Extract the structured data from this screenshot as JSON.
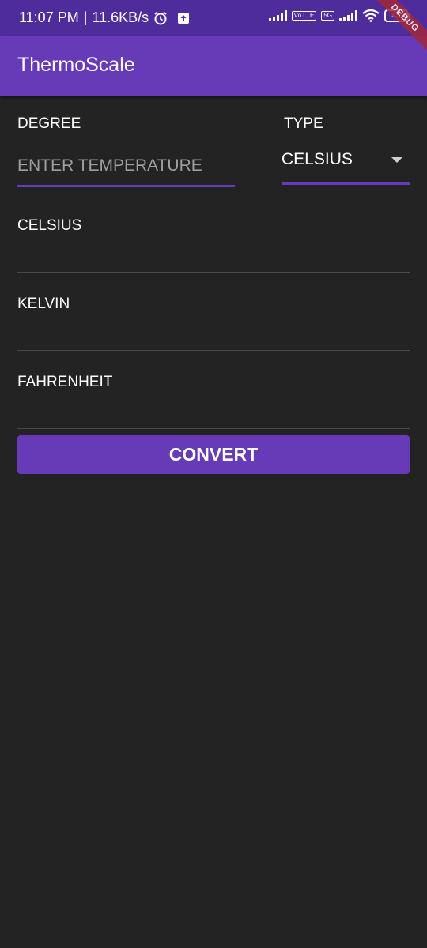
{
  "status_bar": {
    "time": "11:07 PM",
    "separator": "|",
    "speed": "11.6KB/s",
    "alarm_icon": "alarm-icon",
    "upload_icon": "upload-icon",
    "net1_tag": "Vo LTE",
    "net2_tag": "5G",
    "wifi_icon": "wifi-icon",
    "battery": "45"
  },
  "app_bar": {
    "title": "ThermoScale",
    "color": "#673ab7"
  },
  "debug_ribbon": "DEBUG",
  "form": {
    "degree_label": "DEGREE",
    "degree_placeholder": "ENTER TEMPERATURE",
    "type_label": "TYPE",
    "type_selected": "CELSIUS"
  },
  "results": {
    "celsius_label": "CELSIUS",
    "kelvin_label": "KELVIN",
    "fahrenheit_label": "FAHRENHEIT"
  },
  "convert_label": "CONVERT",
  "colors": {
    "accent": "#673ab7",
    "status_bar": "#4f2c9b",
    "background": "#232323"
  }
}
